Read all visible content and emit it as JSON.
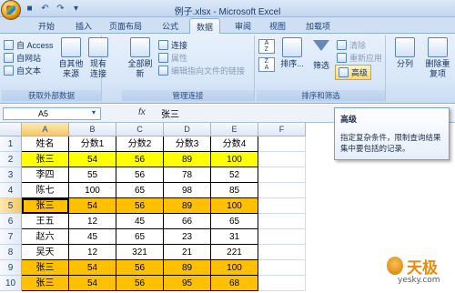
{
  "window": {
    "title": "例子.xlsx - Microsoft Excel"
  },
  "tabs": [
    "开始",
    "插入",
    "页面布局",
    "公式",
    "数据",
    "审阅",
    "视图",
    "加载项"
  ],
  "ribbon": {
    "external": {
      "label": "获取外部数据",
      "access": "自 Access",
      "web": "自网站",
      "text": "自文本",
      "other": "自其他来源",
      "existing": "现有连接"
    },
    "connections": {
      "label": "管理连接",
      "refresh": "全部刷新",
      "connect": "连接",
      "properties": "属性",
      "edit_links": "编辑指向文件的链接"
    },
    "sort_filter": {
      "label": "排序和筛选",
      "sort": "排序...",
      "filter": "筛选",
      "clear": "清除",
      "reapply": "重新应用",
      "advanced": "高级"
    },
    "data_tools": {
      "split": "分列",
      "remove_dup": "删除重复项"
    }
  },
  "formula_bar": {
    "name_box": "A5",
    "fx": "fx",
    "value": "张三"
  },
  "tooltip": {
    "title": "高级",
    "desc": "指定复杂条件，限制查询结果集中要包括的记录。"
  },
  "columns": [
    "A",
    "B",
    "C",
    "D",
    "E",
    "F"
  ],
  "rows": [
    {
      "n": "1",
      "cells": [
        "姓名",
        "分数1",
        "分数2",
        "分数3",
        "分数4"
      ],
      "hl": "none"
    },
    {
      "n": "2",
      "cells": [
        "张三",
        "54",
        "56",
        "89",
        "100"
      ],
      "hl": "yellow"
    },
    {
      "n": "3",
      "cells": [
        "李四",
        "55",
        "56",
        "78",
        "52"
      ],
      "hl": "none"
    },
    {
      "n": "4",
      "cells": [
        "陈七",
        "100",
        "65",
        "98",
        "85"
      ],
      "hl": "none"
    },
    {
      "n": "5",
      "cells": [
        "张三",
        "54",
        "56",
        "89",
        "100"
      ],
      "hl": "orange"
    },
    {
      "n": "6",
      "cells": [
        "王五",
        "12",
        "45",
        "66",
        "65"
      ],
      "hl": "none"
    },
    {
      "n": "7",
      "cells": [
        "赵六",
        "45",
        "65",
        "23",
        "31"
      ],
      "hl": "none"
    },
    {
      "n": "8",
      "cells": [
        "吴天",
        "12",
        "321",
        "21",
        "221"
      ],
      "hl": "none"
    },
    {
      "n": "9",
      "cells": [
        "张三",
        "54",
        "56",
        "89",
        "100"
      ],
      "hl": "orange"
    },
    {
      "n": "10",
      "cells": [
        "张三",
        "54",
        "56",
        "95",
        "68"
      ],
      "hl": "orange"
    }
  ],
  "watermark": {
    "brand": "天极",
    "url": "yesky.com"
  }
}
